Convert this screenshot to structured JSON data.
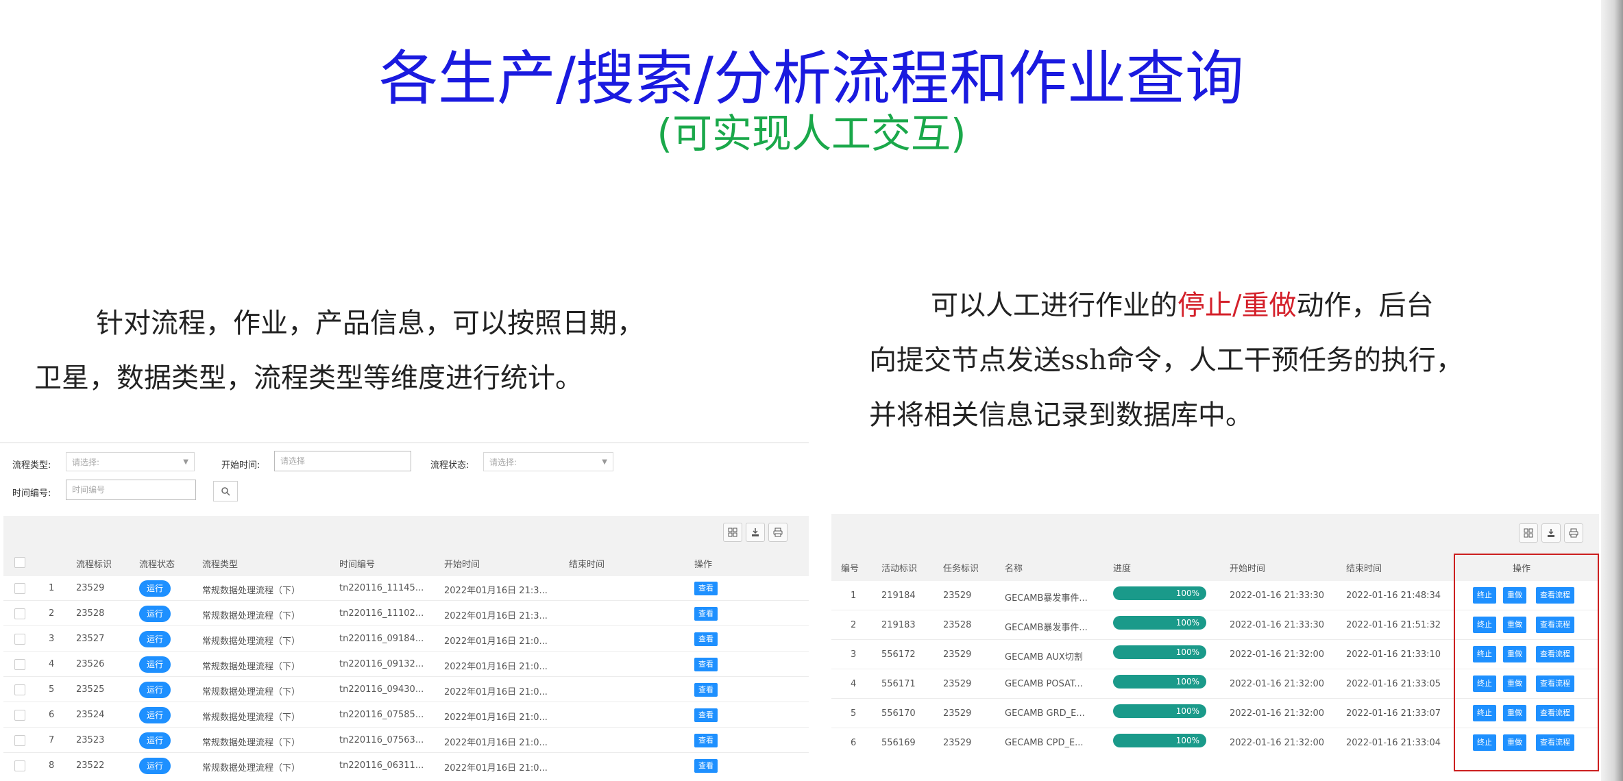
{
  "slide": {
    "title": "各生产/搜索/分析流程和作业查询",
    "subtitle": "(可实现人工交互)",
    "left_desc": {
      "line1": "针对流程，作业，产品信息，可以按照日期，",
      "line2": "卫星，数据类型，流程类型等维度进行统计。"
    },
    "right_desc": {
      "line1_pre": "可以人工进行作业的",
      "line1_red": "停止/重做",
      "line1_post": "动作，后台",
      "line2": "向提交节点发送ssh命令，人工干预任务的执行，",
      "line3": "并将相关信息记录到数据库中。"
    }
  },
  "left_panel": {
    "filters": {
      "flow_type_label": "流程类型:",
      "flow_type_placeholder": "请选择:",
      "start_time_label": "开始时间:",
      "start_time_placeholder": "请选择",
      "flow_status_label": "流程状态:",
      "flow_status_placeholder": "请选择:",
      "time_id_label": "时间编号:",
      "time_id_placeholder": "时间编号"
    },
    "columns": [
      "流程标识",
      "流程状态",
      "流程类型",
      "时间编号",
      "开始时间",
      "结束时间",
      "操作"
    ],
    "rows": [
      {
        "n": "1",
        "id": "23529",
        "status": "运行",
        "type": "常规数据处理流程（下）",
        "time_id": "tn220116_11145...",
        "start": "2022年01月16日 21:3...",
        "end": "",
        "op": "查看"
      },
      {
        "n": "2",
        "id": "23528",
        "status": "运行",
        "type": "常规数据处理流程（下）",
        "time_id": "tn220116_11102...",
        "start": "2022年01月16日 21:3...",
        "end": "",
        "op": "查看"
      },
      {
        "n": "3",
        "id": "23527",
        "status": "运行",
        "type": "常规数据处理流程（下）",
        "time_id": "tn220116_09184...",
        "start": "2022年01月16日 21:0...",
        "end": "",
        "op": "查看"
      },
      {
        "n": "4",
        "id": "23526",
        "status": "运行",
        "type": "常规数据处理流程（下）",
        "time_id": "tn220116_09132...",
        "start": "2022年01月16日 21:0...",
        "end": "",
        "op": "查看"
      },
      {
        "n": "5",
        "id": "23525",
        "status": "运行",
        "type": "常规数据处理流程（下）",
        "time_id": "tn220116_09430...",
        "start": "2022年01月16日 21:0...",
        "end": "",
        "op": "查看"
      },
      {
        "n": "6",
        "id": "23524",
        "status": "运行",
        "type": "常规数据处理流程（下）",
        "time_id": "tn220116_07585...",
        "start": "2022年01月16日 21:0...",
        "end": "",
        "op": "查看"
      },
      {
        "n": "7",
        "id": "23523",
        "status": "运行",
        "type": "常规数据处理流程（下）",
        "time_id": "tn220116_07563...",
        "start": "2022年01月16日 21:0...",
        "end": "",
        "op": "查看"
      },
      {
        "n": "8",
        "id": "23522",
        "status": "运行",
        "type": "常规数据处理流程（下）",
        "time_id": "tn220116_06311...",
        "start": "2022年01月16日 21:0...",
        "end": "",
        "op": "查看"
      }
    ]
  },
  "right_panel": {
    "columns": [
      "编号",
      "活动标识",
      "任务标识",
      "名称",
      "进度",
      "开始时间",
      "结束时间",
      "操作"
    ],
    "buttons": {
      "stop": "终止",
      "redo": "重做",
      "view_flow": "查看流程"
    },
    "rows": [
      {
        "no": "1",
        "act": "219184",
        "task": "23529",
        "name": "GECAMB暴发事件...",
        "progress": 100,
        "progress_label": "100%",
        "start": "2022-01-16 21:33:30",
        "end": "2022-01-16 21:48:34"
      },
      {
        "no": "2",
        "act": "219183",
        "task": "23528",
        "name": "GECAMB暴发事件...",
        "progress": 100,
        "progress_label": "100%",
        "start": "2022-01-16 21:33:30",
        "end": "2022-01-16 21:51:32"
      },
      {
        "no": "3",
        "act": "556172",
        "task": "23529",
        "name": "GECAMB AUX切割",
        "progress": 100,
        "progress_label": "100%",
        "start": "2022-01-16 21:32:00",
        "end": "2022-01-16 21:33:10"
      },
      {
        "no": "4",
        "act": "556171",
        "task": "23529",
        "name": "GECAMB POSAT...",
        "progress": 100,
        "progress_label": "100%",
        "start": "2022-01-16 21:32:00",
        "end": "2022-01-16 21:33:05"
      },
      {
        "no": "5",
        "act": "556170",
        "task": "23529",
        "name": "GECAMB GRD_E...",
        "progress": 100,
        "progress_label": "100%",
        "start": "2022-01-16 21:32:00",
        "end": "2022-01-16 21:33:07"
      },
      {
        "no": "6",
        "act": "556169",
        "task": "23529",
        "name": "GECAMB CPD_E...",
        "progress": 100,
        "progress_label": "100%",
        "start": "2022-01-16 21:32:00",
        "end": "2022-01-16 21:33:04"
      }
    ]
  },
  "colors": {
    "title": "#1a1adf",
    "subtitle": "#1aa84a",
    "highlight": "#d4202a",
    "button": "#1e90ff",
    "progress": "#1a9a8a",
    "frame": "#cc1f1f"
  },
  "icons": [
    "grid-icon",
    "export-icon",
    "print-icon",
    "search-icon",
    "chevron-down-icon"
  ]
}
